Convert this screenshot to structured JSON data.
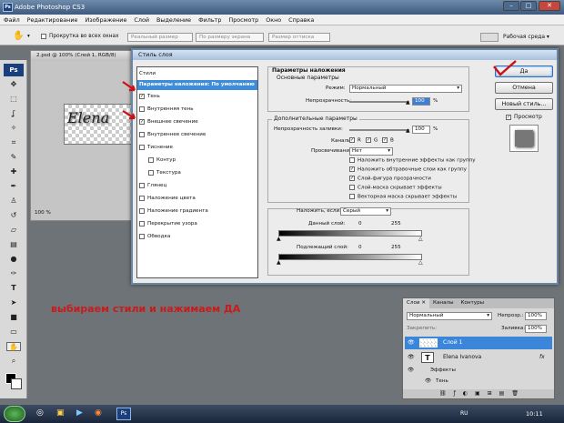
{
  "window": {
    "title": "Adobe Photoshop CS3",
    "logo": "Ps",
    "min": "–",
    "max": "□",
    "close": "✕"
  },
  "menu": [
    "Файл",
    "Редактирование",
    "Изображение",
    "Слой",
    "Выделение",
    "Фильтр",
    "Просмотр",
    "Окно",
    "Справка"
  ],
  "options": {
    "scroll_all": "Прокрутка во всех окнах",
    "actual": "Реальный размер",
    "fit": "По размеру экрана",
    "print": "Размер оттиска",
    "workspace": "Рабочая среда ▾"
  },
  "document": {
    "tab": "2.psd @ 100% (Слой 1, RGB/8)",
    "text": "Elena",
    "zoom": "100 %"
  },
  "dialog": {
    "title": "Стиль слоя",
    "styles_header": "Стили",
    "styles": [
      {
        "label": "Параметры наложения: По умолчанию",
        "checked": null
      },
      {
        "label": "Тень",
        "checked": true
      },
      {
        "label": "Внутренняя тень",
        "checked": false
      },
      {
        "label": "Внешнее свечение",
        "checked": true
      },
      {
        "label": "Внутреннее свечение",
        "checked": false
      },
      {
        "label": "Тиснение",
        "checked": false
      },
      {
        "label": "Контур",
        "checked": false
      },
      {
        "label": "Текстура",
        "checked": false
      },
      {
        "label": "Глянец",
        "checked": false
      },
      {
        "label": "Наложение цвета",
        "checked": false
      },
      {
        "label": "Наложение градиента",
        "checked": false
      },
      {
        "label": "Перекрытие узора",
        "checked": false
      },
      {
        "label": "Обводка",
        "checked": false
      }
    ],
    "blend": {
      "section": "Параметры наложения",
      "basic": "Основные параметры",
      "mode_label": "Режим:",
      "mode_value": "Нормальный",
      "opacity_label": "Непрозрачность:",
      "opacity_value": "100",
      "pct": "%"
    },
    "advanced": {
      "section": "Дополнительные параметры",
      "fill_label": "Непрозрачность заливки:",
      "fill_value": "100",
      "pct": "%",
      "channels_label": "Каналы:",
      "r": "R",
      "g": "G",
      "b": "B",
      "knockout_label": "Просвечивание:",
      "knockout_value": "Нет",
      "options": [
        {
          "label": "Наложить внутренние эффекты как группу",
          "checked": false
        },
        {
          "label": "Наложить обтравочные слои как группу",
          "checked": true
        },
        {
          "label": "Слой-фигура прозрачности",
          "checked": true
        },
        {
          "label": "Слой-маска скрывает эффекты",
          "checked": false
        },
        {
          "label": "Векторная маска скрывает эффекты",
          "checked": false
        }
      ]
    },
    "blendif": {
      "label": "Наложить, если:",
      "value": "Серый",
      "this_layer": "Данный слой:",
      "under_layer": "Подлежащий слой:",
      "min": "0",
      "max": "255"
    },
    "buttons": {
      "ok": "Да",
      "cancel": "Отмена",
      "new_style": "Новый стиль...",
      "preview": "Просмотр"
    }
  },
  "caption": "выбираем стили и нажимаем ДА",
  "layers": {
    "tabs": [
      "Слои ✕",
      "Каналы",
      "Контуры"
    ],
    "mode": "Нормальный",
    "opacity_label": "Непрозр.:",
    "opacity_value": "100%",
    "lock_label": "Закрепить:",
    "fill_label": "Заливка:",
    "fill_value": "100%",
    "items": [
      {
        "name": "Слой 1",
        "kind": "raster",
        "selected": true
      },
      {
        "name": "Elena Ivanova",
        "kind": "text",
        "selected": false
      },
      {
        "name": "Эффекты",
        "kind": "effects",
        "selected": false
      },
      {
        "name": "Тень",
        "kind": "effect",
        "selected": false
      }
    ],
    "fx": "fx"
  },
  "taskbar": {
    "lang": "RU",
    "time": "10:11",
    "ps": "Ps"
  }
}
